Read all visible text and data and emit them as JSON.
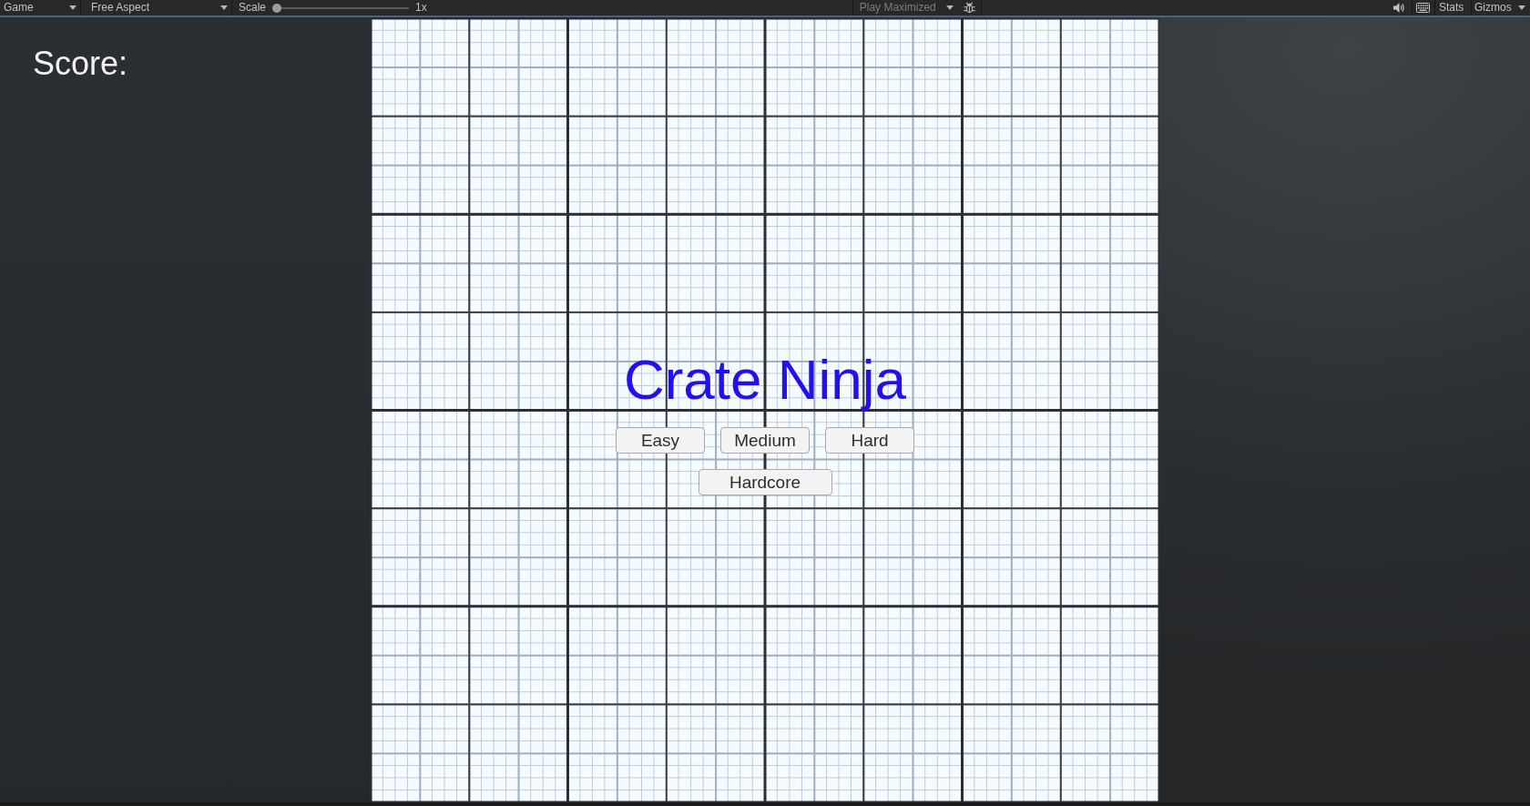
{
  "toolbar": {
    "view_menu": {
      "label": "Game"
    },
    "aspect_menu": {
      "label": "Free Aspect"
    },
    "scale": {
      "label": "Scale",
      "level": 0,
      "reading": "1x"
    },
    "play_mode_menu": {
      "label": "Play Maximized"
    },
    "stats_button": {
      "label": "Stats"
    },
    "gizmos_menu": {
      "label": "Gizmos"
    }
  },
  "game_view": {
    "score_label": "Score:",
    "title": "Crate Ninja",
    "button_rows": [
      {
        "buttons": [
          {
            "label": "Easy"
          },
          {
            "label": "Medium"
          },
          {
            "label": "Hard"
          }
        ]
      },
      {
        "buttons": [
          {
            "label": "Hardcore"
          }
        ]
      }
    ]
  }
}
